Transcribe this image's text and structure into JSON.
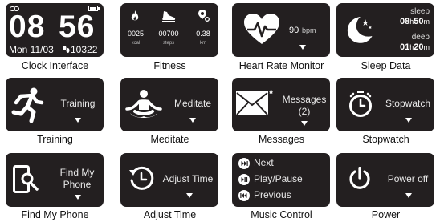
{
  "clock": {
    "hour": "08",
    "minute": "56",
    "date": "Mon 11/03",
    "steps": "10322",
    "caption": "Clock Interface"
  },
  "fitness": {
    "kcal_value": "0025",
    "kcal_unit": "kcal",
    "steps_value": "00700",
    "steps_unit": "steps",
    "km_value": "0.38",
    "km_unit": "km",
    "caption": "Fitness"
  },
  "heart": {
    "value": "90",
    "unit": "bpm",
    "caption": "Heart Rate Monitor"
  },
  "sleep": {
    "sleep_label": "sleep",
    "sleep_h": "08",
    "sleep_h_unit": "h",
    "sleep_m": "50",
    "sleep_m_unit": "m",
    "deep_label": "deep",
    "deep_h": "01",
    "deep_h_unit": "h",
    "deep_m": "20",
    "deep_m_unit": "m",
    "caption": "Sleep Data"
  },
  "training": {
    "label": "Training",
    "caption": "Training"
  },
  "meditate": {
    "label": "Meditate",
    "caption": "Meditate"
  },
  "messages": {
    "label": "Messages",
    "count": "(2)",
    "badge": "*",
    "caption": "Messages"
  },
  "stopwatch": {
    "label": "Stopwatch",
    "caption": "Stopwatch"
  },
  "findphone": {
    "label_line1": "Find My",
    "label_line2": "Phone",
    "caption": "Find My Phone"
  },
  "adjusttime": {
    "label": "Adjust Time",
    "caption": "Adjust Time"
  },
  "music": {
    "next": "Next",
    "playpause": "Play/Pause",
    "previous": "Previous",
    "caption": "Music Control"
  },
  "power": {
    "label": "Power off",
    "caption": "Power"
  },
  "icons": [
    "link-icon",
    "battery-icon",
    "footprints-icon",
    "flame-icon",
    "running-shoe-icon",
    "location-pin-icon",
    "heart-pulse-icon",
    "moon-stars-icon",
    "runner-icon",
    "meditation-icon",
    "envelope-icon",
    "stopwatch-icon",
    "phone-search-icon",
    "clock-arrow-icon",
    "next-track-icon",
    "play-pause-icon",
    "previous-track-icon",
    "power-icon"
  ],
  "colors": {
    "screen": "#231f20",
    "text": "#ffffff",
    "caption": "#111111"
  }
}
